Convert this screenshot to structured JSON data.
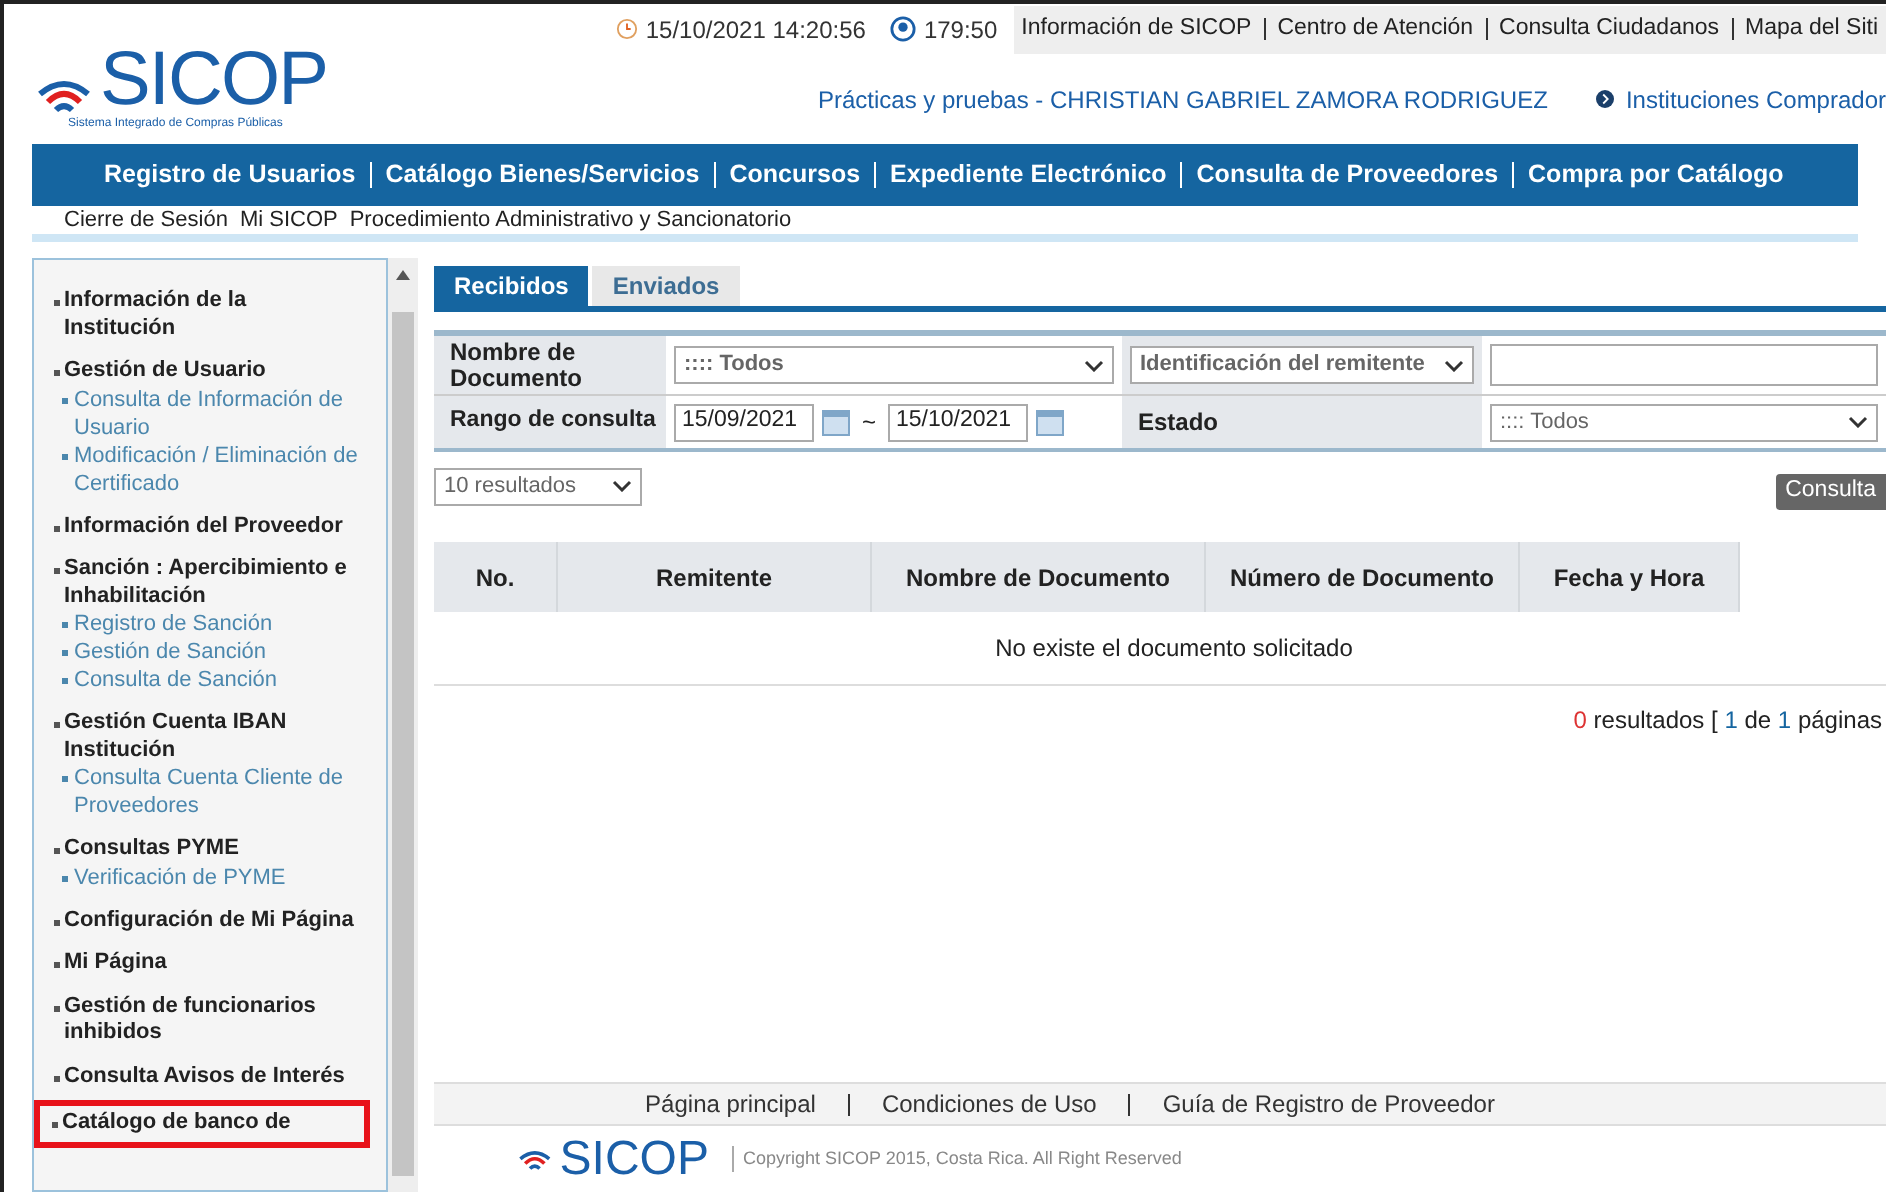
{
  "header": {
    "datetime": "15/10/2021 14:20:56",
    "timer": "179:50",
    "top_links": [
      "Información de SICOP",
      "Centro de Atención",
      "Consulta Ciudadanos",
      "Mapa del Siti"
    ],
    "logo": {
      "name": "SICOP",
      "tagline": "Sistema Integrado de Compras Públicas"
    },
    "user": "Prácticas y pruebas - CHRISTIAN GABRIEL ZAMORA RODRIGUEZ",
    "institution_link": "Instituciones Comprador"
  },
  "main_nav": [
    "Registro de Usuarios",
    "Catálogo Bienes/Servicios",
    "Concursos",
    "Expediente Electrónico",
    "Consulta de Proveedores",
    "Compra por Catálogo"
  ],
  "sub_nav": [
    "Cierre de Sesión",
    "Mi SICOP",
    "Procedimiento Administrativo y Sancionatorio"
  ],
  "sidebar": {
    "items": [
      {
        "label": "Información de la Institución",
        "highlighted": false
      },
      {
        "label": "Gestión de Usuario",
        "highlighted": false,
        "children": [
          "Consulta de Información de Usuario",
          "Modificación / Eliminación de Certificado"
        ]
      },
      {
        "label": "Información del Proveedor",
        "highlighted": false
      },
      {
        "label": "Sanción : Apercibimiento e Inhabilitación",
        "highlighted": false,
        "children": [
          "Registro de Sanción",
          "Gestión de Sanción",
          "Consulta de Sanción"
        ]
      },
      {
        "label": "Gestión Cuenta IBAN Institución",
        "highlighted": false,
        "children": [
          "Consulta Cuenta Cliente de Proveedores"
        ]
      },
      {
        "label": "Consultas PYME",
        "highlighted": false,
        "children": [
          "Verificación de PYME"
        ]
      },
      {
        "label": "Configuración de Mi Página",
        "highlighted": false
      },
      {
        "label": "Mi Página",
        "highlighted": false
      },
      {
        "label": "Gestión de funcionarios inhibidos",
        "highlighted": false
      },
      {
        "label": "Consulta Avisos de Interés",
        "highlighted": false
      },
      {
        "label": "Catálogo de banco de",
        "highlighted": true
      }
    ]
  },
  "tabs": [
    {
      "label": "Recibidos",
      "selected": true
    },
    {
      "label": "Enviados",
      "selected": false
    }
  ],
  "filters": {
    "doc_name_label": "Nombre de Documento",
    "doc_name_value": ":::: Todos",
    "sender_select": "Identificación del remitente",
    "range_label": "Rango de consulta",
    "date_from": "15/09/2021",
    "range_sep": "~",
    "date_to": "15/10/2021",
    "status_label": "Estado",
    "status_value": ":::: Todos"
  },
  "page_size": "10 resultados",
  "search_button": "Consulta",
  "table": {
    "columns": [
      "No.",
      "Remitente",
      "Nombre de Documento",
      "Número de Documento",
      "Fecha y Hora"
    ],
    "empty_message": "No existe el documento solicitado"
  },
  "pagination": {
    "count": "0",
    "label": "resultados [",
    "page": "1",
    "of": "de",
    "pages": "1",
    "suffix": "páginas"
  },
  "footer": {
    "links": [
      "Página principal",
      "Condiciones de Uso",
      "Guía de Registro de Proveedor"
    ],
    "logo": "SICOP",
    "copyright": "Copyright SICOP 2015, Costa Rica. All Right Reserved"
  }
}
